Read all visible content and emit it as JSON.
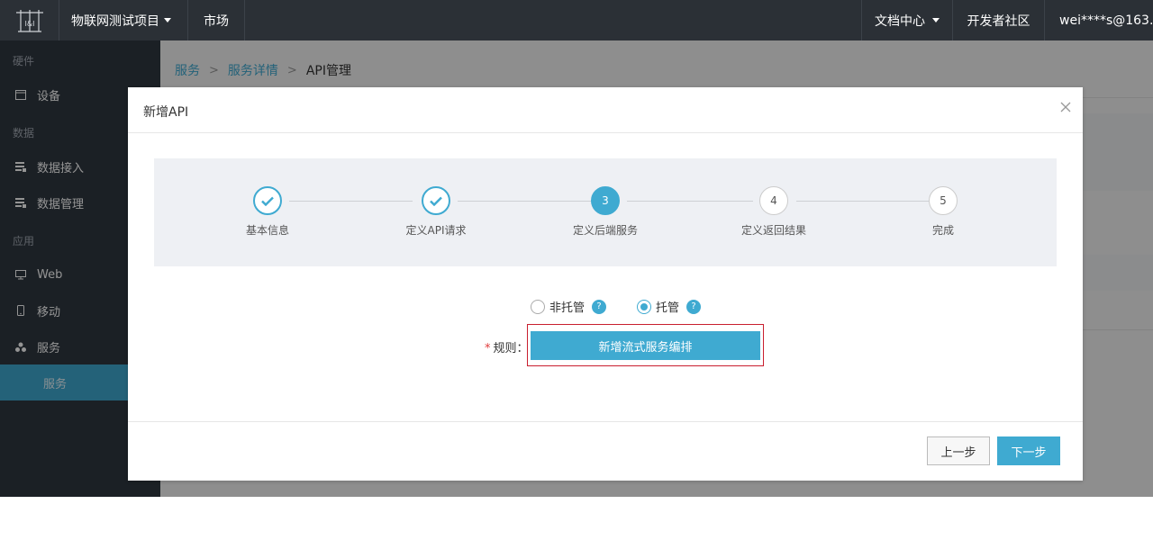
{
  "header": {
    "project": "物联网测试项目",
    "market": "市场",
    "docs": "文档中心",
    "community": "开发者社区",
    "user": "wei****s@163.com"
  },
  "sidebar": {
    "sections": [
      {
        "title": "硬件"
      },
      {
        "title": "数据"
      },
      {
        "title": "应用"
      }
    ],
    "items": [
      {
        "label": "设备",
        "icon": "device-icon"
      },
      {
        "label": "数据接入",
        "icon": "data-icon"
      },
      {
        "label": "数据管理",
        "icon": "data-icon"
      },
      {
        "label": "Web",
        "icon": "monitor-icon"
      },
      {
        "label": "移动",
        "icon": "mobile-icon"
      },
      {
        "label": "服务",
        "icon": "service-icon"
      }
    ],
    "active_sub": "服务"
  },
  "breadcrumb": {
    "items": [
      "服务",
      "服务详情"
    ],
    "current": "API管理",
    "separator": ">"
  },
  "modal": {
    "title": "新增API",
    "steps": [
      {
        "label": "基本信息",
        "state": "done",
        "num": "1"
      },
      {
        "label": "定义API请求",
        "state": "done",
        "num": "2"
      },
      {
        "label": "定义后端服务",
        "state": "active",
        "num": "3"
      },
      {
        "label": "定义返回结果",
        "state": "todo",
        "num": "4"
      },
      {
        "label": "完成",
        "state": "todo",
        "num": "5"
      }
    ],
    "hosting": {
      "options": [
        "非托管",
        "托管"
      ],
      "selected": "托管",
      "help": "?"
    },
    "rule": {
      "required_mark": "*",
      "label": "规则：",
      "button": "新增流式服务编排"
    },
    "buttons": {
      "prev": "上一步",
      "next": "下一步"
    }
  },
  "colors": {
    "accent": "#3faad1",
    "topbar": "#2b3036",
    "sidebar": "#2f3741",
    "highlight_border": "#c91f2f"
  }
}
